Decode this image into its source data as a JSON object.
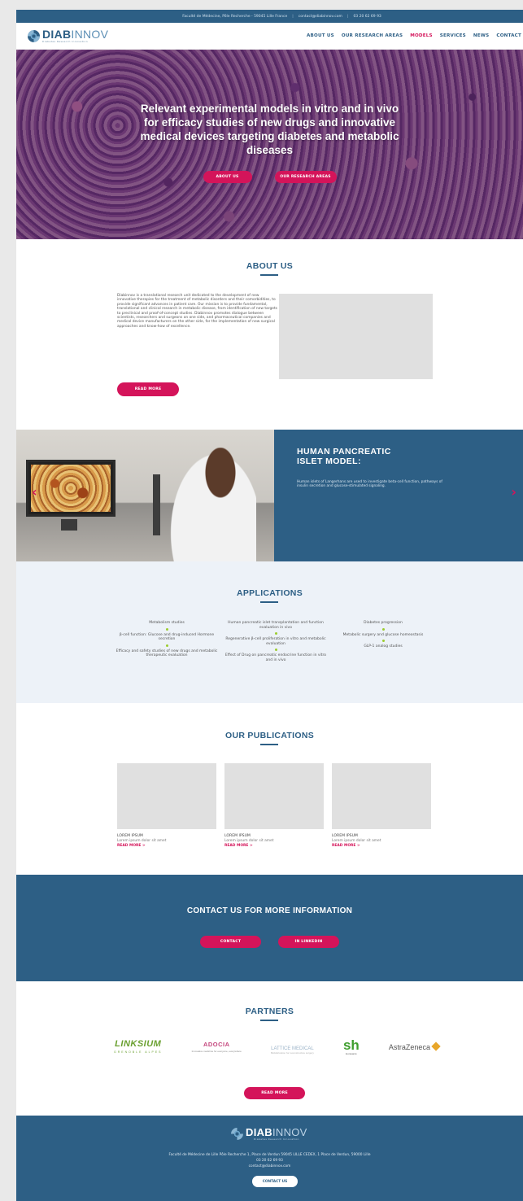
{
  "topbar": {
    "address": "Faculté de Médecine, Pôle Recherche - 59045 Lille France",
    "email": "contact@diabinnov.com",
    "phone": "03 20 62 69 93",
    "separator": "|"
  },
  "brand": {
    "name_bold": "DIAB",
    "name_light": "INNOV",
    "tagline": "Diabetes Research Innovation"
  },
  "nav": {
    "items": [
      {
        "label": "ABOUT US",
        "active": false
      },
      {
        "label": "OUR RESEARCH AREAS",
        "active": false
      },
      {
        "label": "MODELS",
        "active": true
      },
      {
        "label": "SERVICES",
        "active": false
      },
      {
        "label": "NEWS",
        "active": false
      },
      {
        "label": "CONTACT",
        "active": false
      }
    ]
  },
  "hero": {
    "title": "Relevant experimental models in vitro and in vivo for efficacy studies of new drugs and innovative medical devices targeting diabetes and metabolic diseases",
    "btn_about": "ABOUT US",
    "btn_research": "OUR RESEARCH AREAS"
  },
  "about": {
    "title": "ABOUT US",
    "text": "Diabinnov is a translational research unit dedicated to the development of new innovative therapies for the treatment of metabolic disorders and their comorbidities, to provide significant advances in patient care. Our mission is to provide fundamental, translational and clinical research in metabolic disease, from identification of new targets to preclinical and proof-of-concept studies. Diabinnov promotes dialogue between scientists, researchers and surgeons on one side, and pharmaceutical companies and medical device manufacturers on the other side, for the implementation of new surgical approaches and know-how of excellence.",
    "btn": "READ MORE"
  },
  "slider": {
    "title_line1": "HUMAN PANCREATIC",
    "title_line2": "ISLET MODEL:",
    "description": "Human islets of Langerhans are used to investigate beta-cell function, pathways of insulin secretion and glucose-stimulated signaling.",
    "prev": "‹",
    "next": "›"
  },
  "applications": {
    "title": "APPLICATIONS",
    "columns": [
      [
        "Metabolism studies",
        "β-cell function: Glucose and drug-induced Hormone secretion",
        "Efficacy and safety studies of new drugs and metabolic therapeutic evaluation"
      ],
      [
        "Human pancreatic islet transplantation and function evaluation in vivo",
        "Regenerative β-cell proliferation in vitro and metabolic evaluation",
        "Effect of Drug on pancreatic endocrine function in vitro and in vivo"
      ],
      [
        "Diabetes progression",
        "Metabolic surgery and glucose homeostasis",
        "GLP-1 analog studies"
      ]
    ]
  },
  "publications": {
    "title": "OUR PUBLICATIONS",
    "items": [
      {
        "title": "LOREM IPSUM",
        "text": "Lorem ipsum dolor sit amet",
        "more": "READ MORE >"
      },
      {
        "title": "LOREM IPSUM",
        "text": "Lorem ipsum dolor sit amet",
        "more": "READ MORE >"
      },
      {
        "title": "LOREM IPSUM",
        "text": "Lorem ipsum dolor sit amet",
        "more": "READ MORE >"
      }
    ]
  },
  "contact": {
    "title": "CONTACT US FOR MORE INFORMATION",
    "btn_contact": "CONTACT",
    "btn_linkedin": "IN LINKEDIN"
  },
  "partners": {
    "title": "PARTNERS",
    "logos": [
      {
        "name": "LINKSIUM",
        "sub": "GRENOBLE ALPES"
      },
      {
        "name": "ADOCIA",
        "sub": "Innovative medicine for everyone, everywhere"
      },
      {
        "name": "LATTICE MEDICAL",
        "sub": "Biofabrication for reconstructive surgery"
      },
      {
        "name": "sh",
        "sub": "Eurasanté"
      },
      {
        "name": "AstraZeneca",
        "sub": ""
      }
    ],
    "btn": "READ MORE"
  },
  "footer": {
    "brand_bold": "DIAB",
    "brand_light": "INNOV",
    "tagline": "Diabetes Research Innovation",
    "address": "Faculté de Médecine de Lille Pôle Recherche 1, Place de Verdun 59045 LILLE CEDEX, 1 Place de Verdun, 59000 Lille",
    "phone": "03 20 62 69 93",
    "email": "contact@diabinnov.com",
    "btn": "CONTACT US"
  },
  "colors": {
    "primary": "#2d5f85",
    "accent": "#d4145a",
    "bullet": "#9ccc2e"
  }
}
